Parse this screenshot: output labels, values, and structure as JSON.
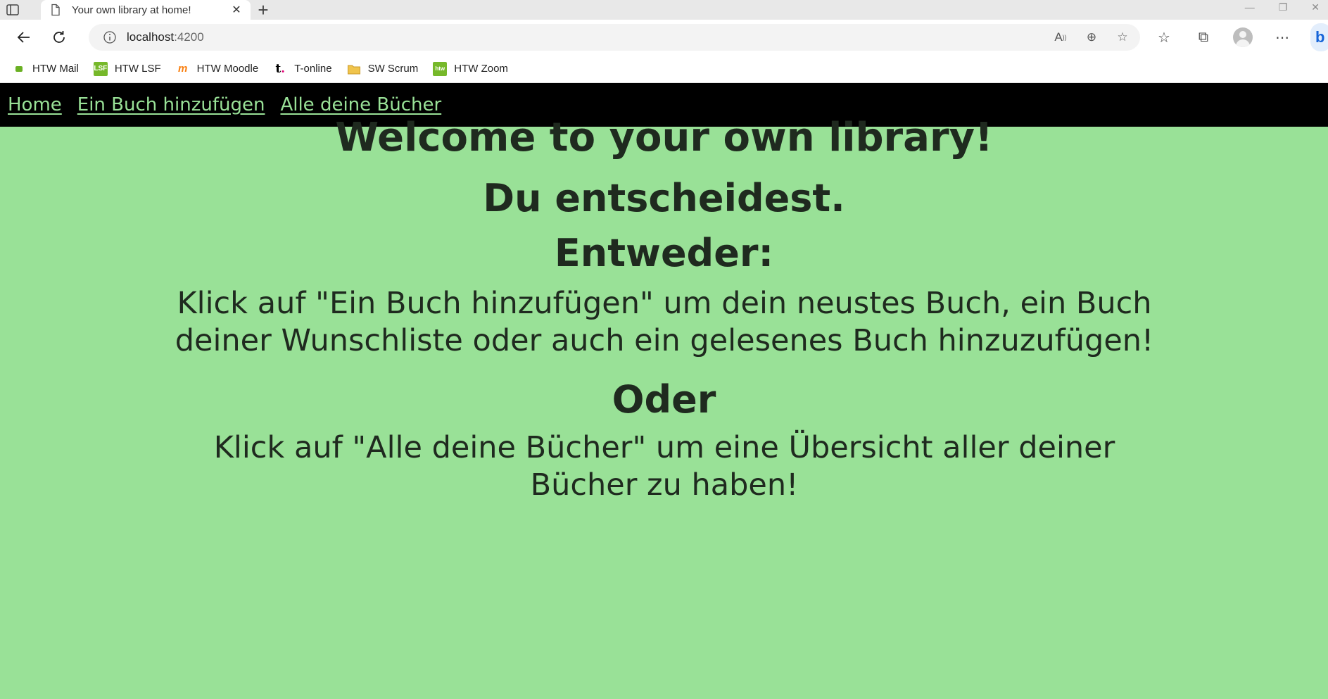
{
  "browser": {
    "tab_title": "Your own library at home!",
    "url_host": "localhost",
    "url_port": ":4200",
    "bookmarks": [
      {
        "label": "HTW Mail",
        "icon": "htw-mail-icon",
        "color": "#6ab023"
      },
      {
        "label": "HTW LSF",
        "icon": "htw-lsf-icon",
        "color": "#76b82a"
      },
      {
        "label": "HTW Moodle",
        "icon": "moodle-icon",
        "color": "#f98012"
      },
      {
        "label": "T-online",
        "icon": "t-online-icon",
        "color": "#e20074"
      },
      {
        "label": "SW Scrum",
        "icon": "folder-icon",
        "color": "#f0c44c"
      },
      {
        "label": "HTW Zoom",
        "icon": "htw-zoom-icon",
        "color": "#76b82a"
      }
    ]
  },
  "nav": {
    "home": "Home",
    "add_book": "Ein Buch hinzufügen",
    "all_books": "Alle deine Bücher"
  },
  "content": {
    "welcome": "Welcome to your own library!",
    "decide": "Du entscheidest.",
    "either": "Entweder:",
    "either_text": "Klick auf \"Ein Buch hinzufügen\" um dein neustes Buch, ein Buch deiner Wunschliste oder auch ein gelesenes Buch hinzuzufügen!",
    "or": "Oder",
    "or_text": "Klick auf \"Alle deine Bücher\" um eine Übersicht aller deiner Bücher zu haben!"
  },
  "colors": {
    "page_background": "#99e197",
    "nav_background": "#000000",
    "nav_link": "#99e197",
    "text": "#1f2a1f"
  }
}
